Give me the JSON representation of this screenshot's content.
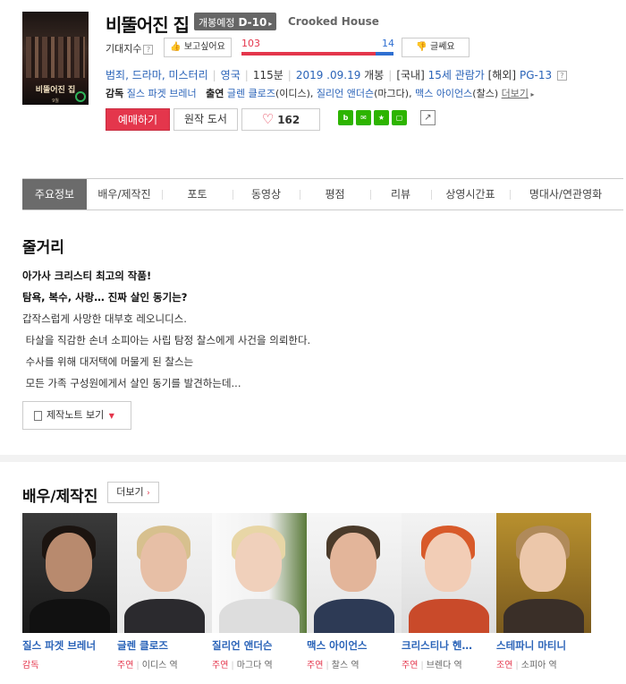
{
  "header": {
    "title": "비뚤어진 집",
    "open_label": "개봉예정",
    "dday": "D-10",
    "title_en": "Crooked House",
    "expect_label": "기대지수",
    "want_button": "보고싶어요",
    "meh_button": "글쎄요",
    "want_count": "103",
    "meh_count": "14",
    "want_ratio": 0.88,
    "genre": "범죄, 드라마, 미스터리",
    "country": "영국",
    "runtime": "115분",
    "release": "2019 .09.19",
    "release_suffix": "개봉",
    "rating_kr_label": "[국내]",
    "rating_kr": "15세 관람가",
    "rating_intl_label": "[해외]",
    "rating_intl": "PG-13",
    "director_label": "감독",
    "director": "질스 파겟 브레너",
    "cast_label": "출연",
    "cast_1": "글렌 클로즈",
    "cast_1_role": "(이디스),",
    "cast_2": "질리언 앤더슨",
    "cast_2_role": "(마그다),",
    "cast_3": "맥스 아이언스",
    "cast_3_role": "(찰스)",
    "more_link": "더보기",
    "reserve_button": "예매하기",
    "book_button": "원작 도서",
    "like_count": "162"
  },
  "poster": {
    "title": "비뚤어진 집",
    "sub": "9월"
  },
  "tabs": [
    "주요정보",
    "배우/제작진",
    "포토",
    "동영상",
    "평점",
    "리뷰",
    "상영시간표",
    "명대사/연관영화"
  ],
  "plot": {
    "heading": "줄거리",
    "line1": "아가사 크리스티 최고의 작품!",
    "line2": "탐욕, 복수, 사랑… 진짜 살인 동기는?",
    "line3": "갑작스럽게 사망한 대부호 레오니디스.",
    "line4": " 타살을 직감한 손녀 소피아는 사립 탐정 찰스에게 사건을 의뢰한다.",
    "line5": " 수사를 위해 대저택에 머물게 된 찰스는",
    "line6": " 모든 가족 구성원에게서 살인 동기를 발견하는데...",
    "note_button": "제작노트 보기"
  },
  "cast_section": {
    "heading": "배우/제작진",
    "more_button": "더보기",
    "people": [
      {
        "name": "질스 파겟 브레너",
        "role_type": "감독",
        "role": ""
      },
      {
        "name": "글렌 클로즈",
        "role_type": "주연",
        "role": "이디스 역"
      },
      {
        "name": "질리언 앤더슨",
        "role_type": "주연",
        "role": "마그다 역"
      },
      {
        "name": "맥스 아이언스",
        "role_type": "주연",
        "role": "찰스 역"
      },
      {
        "name": "크리스티나 헨…",
        "role_type": "주연",
        "role": "브렌다 역"
      },
      {
        "name": "스테파니 마티니",
        "role_type": "조연",
        "role": "소피아 역"
      }
    ]
  }
}
